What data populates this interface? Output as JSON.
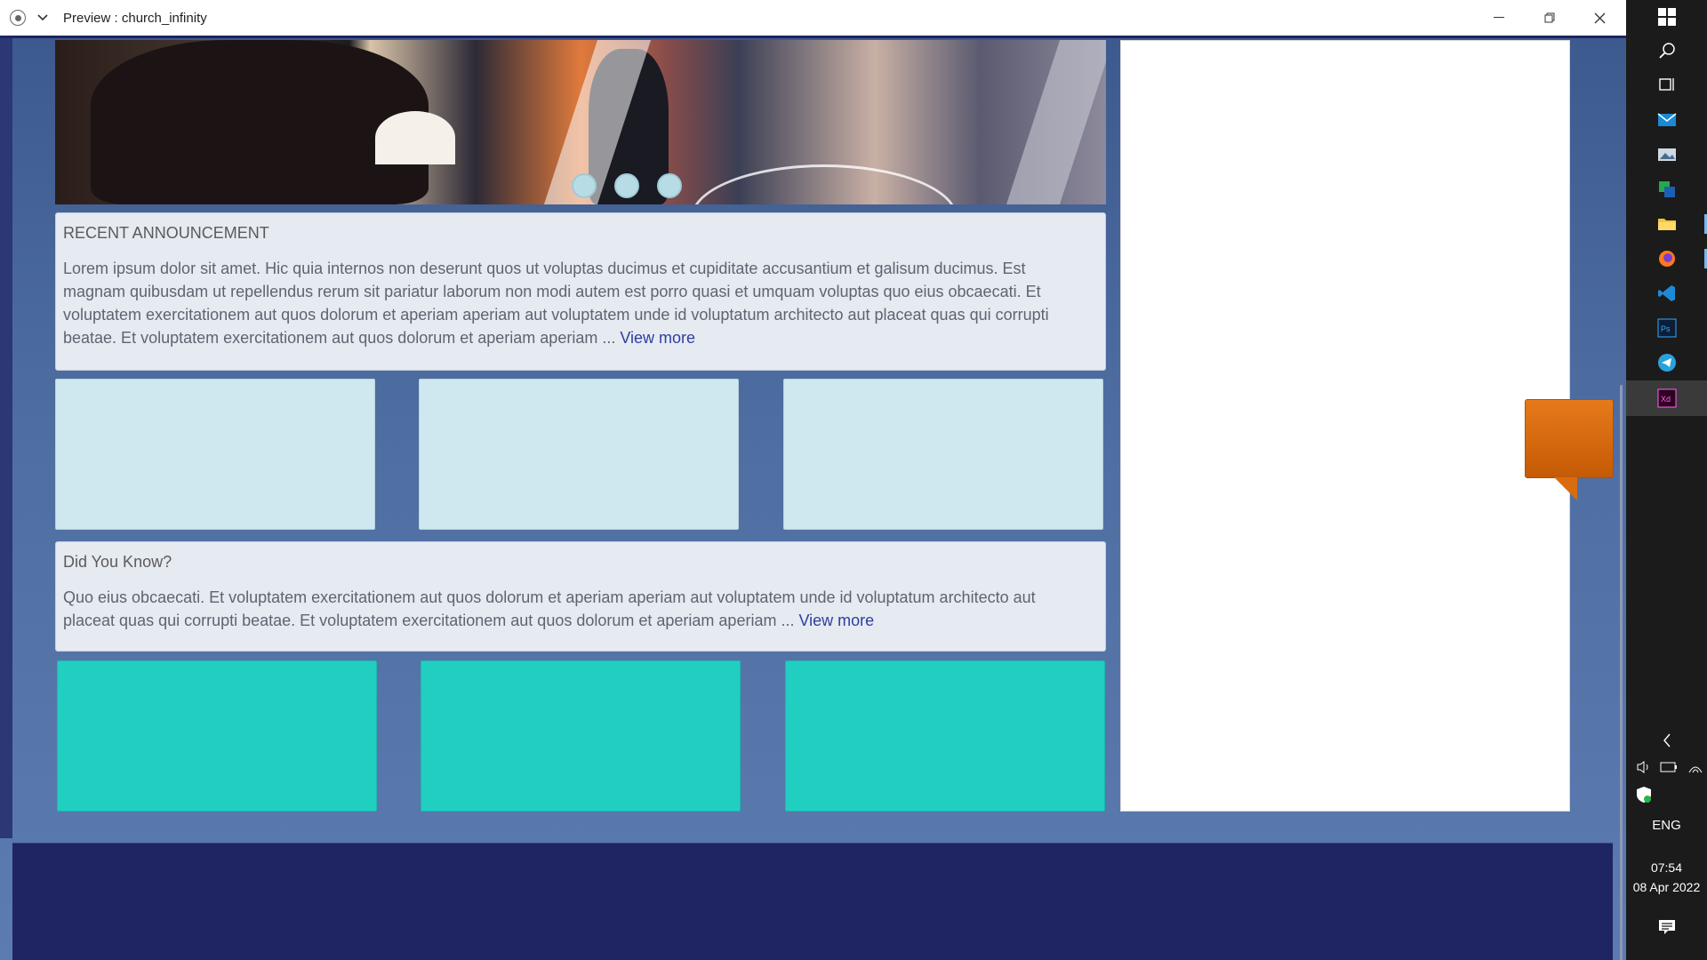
{
  "window": {
    "title": "Preview : church_infinity"
  },
  "announcement": {
    "heading": "RECENT ANNOUNCEMENT",
    "body": "Lorem ipsum dolor sit amet. Hic quia internos non deserunt quos ut voluptas ducimus et cupiditate accusantium et galisum ducimus. Est magnam quibusdam ut repellendus rerum sit pariatur laborum non modi autem est porro quasi et umquam voluptas quo eius obcaecati. Et voluptatem exercitationem aut quos dolorum et aperiam aperiam aut voluptatem unde id voluptatum architecto aut placeat quas qui corrupti beatae.  Et voluptatem exercitationem aut quos dolorum et aperiam aperiam ... ",
    "link": "View more"
  },
  "did_you_know": {
    "heading": "Did You Know?",
    "body": "Quo eius obcaecati. Et voluptatem exercitationem aut quos dolorum et aperiam aperiam aut voluptatem unde id voluptatum architecto aut placeat quas qui corrupti beatae.  Et voluptatem exercitationem aut quos dolorum et aperiam aperiam ... ",
    "link": "View more"
  },
  "slider": {
    "dot_count": 3
  },
  "taskbar": {
    "language": "ENG",
    "time": "07:54",
    "date": "08 Apr 2022",
    "icons": [
      "windows-start-icon",
      "search-icon",
      "task-view-icon",
      "mail-icon",
      "photos-icon",
      "app-icon",
      "file-explorer-icon",
      "firefox-icon",
      "vscode-icon",
      "photoshop-icon",
      "telegram-icon",
      "xd-icon"
    ]
  },
  "colors": {
    "accent_teal": "#21cfc0",
    "light_card": "#cfe7ee",
    "footer": "#1f2560",
    "chat_orange": "#e67a1a",
    "link": "#2c3fa0"
  }
}
